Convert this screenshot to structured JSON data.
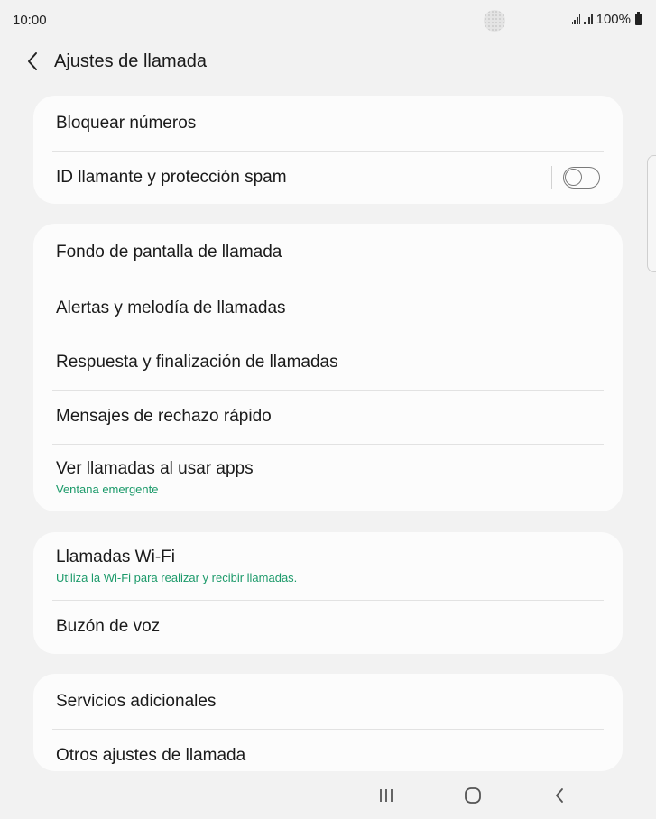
{
  "status": {
    "time": "10:00",
    "battery_text": "100%",
    "icons": [
      "signal-icon",
      "signal-icon",
      "battery-icon"
    ]
  },
  "header": {
    "title": "Ajustes de llamada",
    "back_icon": "chevron-left-icon"
  },
  "groups": [
    {
      "items": [
        {
          "label": "Bloquear números"
        },
        {
          "label": "ID llamante y protección spam",
          "toggle": false
        }
      ]
    },
    {
      "items": [
        {
          "label": "Fondo de pantalla de llamada"
        },
        {
          "label": "Alertas y melodía de llamadas"
        },
        {
          "label": "Respuesta y finalización de llamadas"
        },
        {
          "label": "Mensajes de rechazo rápido"
        },
        {
          "label": "Ver llamadas al usar apps",
          "sub": "Ventana emergente"
        }
      ]
    },
    {
      "items": [
        {
          "label": "Llamadas Wi-Fi",
          "sub": "Utiliza la Wi-Fi para realizar y recibir llamadas."
        },
        {
          "label": "Buzón de voz"
        }
      ]
    },
    {
      "items": [
        {
          "label": "Servicios adicionales"
        },
        {
          "label": "Otros ajustes de llamada"
        }
      ]
    }
  ],
  "nav": {
    "icons": [
      "recent-apps-icon",
      "home-icon",
      "back-icon"
    ]
  },
  "colors": {
    "background": "#f2f2f2",
    "card": "#fcfcfc",
    "accent_sub": "#1c9a6a"
  }
}
